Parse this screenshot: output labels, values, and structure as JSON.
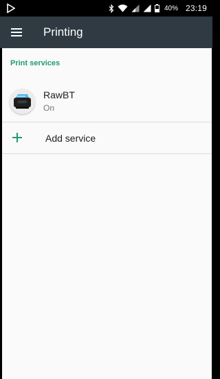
{
  "status_bar": {
    "battery_percent": "40%",
    "time": "23:19",
    "icons": [
      "play-store-notification-icon",
      "bluetooth-icon",
      "wifi-icon",
      "signal-icon",
      "signal-icon",
      "battery-icon"
    ]
  },
  "app_bar": {
    "title": "Printing",
    "menu_icon": "hamburger-menu-icon"
  },
  "section": {
    "header": "Print services"
  },
  "services": [
    {
      "name": "RawBT",
      "status": "On",
      "icon": "printer-app-icon"
    }
  ],
  "add_service": {
    "label": "Add service",
    "icon": "plus-icon"
  },
  "colors": {
    "app_bar": "#2f3a42",
    "accent": "#1f9a73",
    "background": "#fafafa"
  }
}
